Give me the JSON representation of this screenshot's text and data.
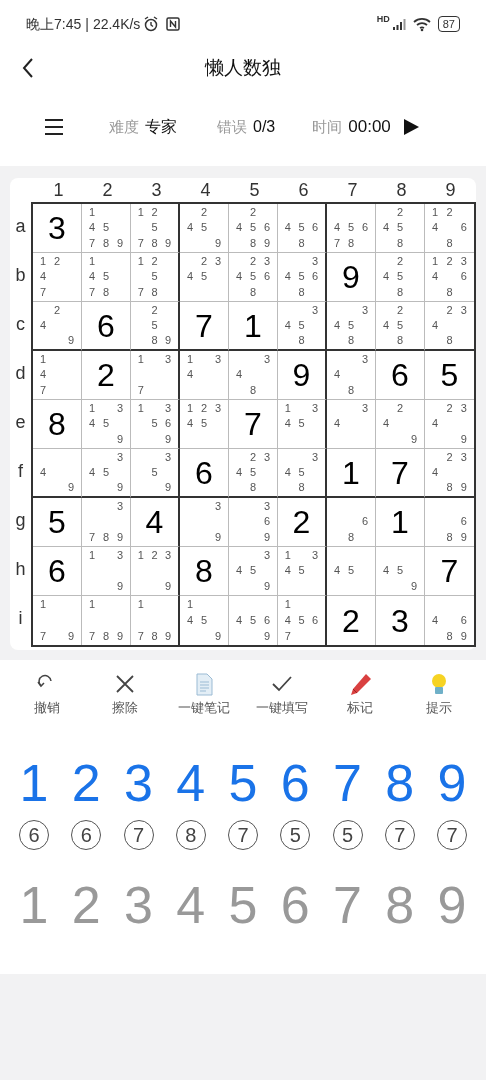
{
  "status_bar": {
    "time": "晚上7:45",
    "separator": "|",
    "speed": "22.4K/s",
    "network": "HD",
    "battery": "87"
  },
  "header": {
    "title": "懒人数独"
  },
  "info_bar": {
    "difficulty_label": "难度",
    "difficulty": "专家",
    "errors_label": "错误",
    "errors": "0/3",
    "time_label": "时间",
    "time": "00:00"
  },
  "column_labels": [
    "1",
    "2",
    "3",
    "4",
    "5",
    "6",
    "7",
    "8",
    "9"
  ],
  "row_labels": [
    "a",
    "b",
    "c",
    "d",
    "e",
    "f",
    "g",
    "h",
    "i"
  ],
  "grid": [
    [
      {
        "kind": "value",
        "value": "3"
      },
      {
        "kind": "notes",
        "notes": [
          {
            "digit": "1",
            "kind": "tl"
          },
          {
            "digit": "4",
            "kind": "ml"
          },
          {
            "digit": "5",
            "kind": "mc"
          },
          {
            "digit": "7",
            "kind": "bl"
          },
          {
            "digit": "8",
            "kind": "bc"
          },
          {
            "digit": "9",
            "kind": "br"
          }
        ]
      },
      {
        "kind": "notes",
        "notes": [
          {
            "digit": "1",
            "kind": "tl"
          },
          {
            "digit": "2",
            "kind": "tc"
          },
          {
            "digit": "5",
            "kind": "mc"
          },
          {
            "digit": "7",
            "kind": "bl"
          },
          {
            "digit": "8",
            "kind": "bc"
          },
          {
            "digit": "9",
            "kind": "br"
          }
        ]
      },
      {
        "kind": "notes",
        "notes": [
          {
            "digit": "2",
            "kind": "tc"
          },
          {
            "digit": "4",
            "kind": "ml"
          },
          {
            "digit": "5",
            "kind": "mc"
          },
          {
            "digit": "9",
            "kind": "br"
          }
        ]
      },
      {
        "kind": "notes",
        "notes": [
          {
            "digit": "2",
            "kind": "tc"
          },
          {
            "digit": "4",
            "kind": "ml"
          },
          {
            "digit": "5",
            "kind": "mc"
          },
          {
            "digit": "6",
            "kind": "mr"
          },
          {
            "digit": "8",
            "kind": "bc"
          },
          {
            "digit": "9",
            "kind": "br"
          }
        ]
      },
      {
        "kind": "notes",
        "notes": [
          {
            "digit": "4",
            "kind": "ml"
          },
          {
            "digit": "5",
            "kind": "mc"
          },
          {
            "digit": "6",
            "kind": "mr"
          },
          {
            "digit": "8",
            "kind": "bc"
          }
        ]
      },
      {
        "kind": "notes",
        "notes": [
          {
            "digit": "4",
            "kind": "ml"
          },
          {
            "digit": "5",
            "kind": "mc"
          },
          {
            "digit": "6",
            "kind": "mr"
          },
          {
            "digit": "7",
            "kind": "bl"
          },
          {
            "digit": "8",
            "kind": "bc"
          }
        ]
      },
      {
        "kind": "notes",
        "notes": [
          {
            "digit": "2",
            "kind": "tc"
          },
          {
            "digit": "4",
            "kind": "ml"
          },
          {
            "digit": "5",
            "kind": "mc"
          },
          {
            "digit": "8",
            "kind": "bc"
          }
        ]
      },
      {
        "kind": "notes",
        "notes": [
          {
            "digit": "1",
            "kind": "tl"
          },
          {
            "digit": "2",
            "kind": "tc"
          },
          {
            "digit": "4",
            "kind": "ml"
          },
          {
            "digit": "6",
            "kind": "mr"
          },
          {
            "digit": "8",
            "kind": "bc"
          }
        ]
      }
    ],
    [
      {
        "kind": "notes",
        "notes": [
          {
            "digit": "1",
            "kind": "tl"
          },
          {
            "digit": "2",
            "kind": "tc"
          },
          {
            "digit": "4",
            "kind": "ml"
          },
          {
            "digit": "7",
            "kind": "bl"
          }
        ]
      },
      {
        "kind": "notes",
        "notes": [
          {
            "digit": "1",
            "kind": "tl"
          },
          {
            "digit": "4",
            "kind": "ml"
          },
          {
            "digit": "5",
            "kind": "mc"
          },
          {
            "digit": "7",
            "kind": "bl"
          },
          {
            "digit": "8",
            "kind": "bc"
          }
        ]
      },
      {
        "kind": "notes",
        "notes": [
          {
            "digit": "1",
            "kind": "tl"
          },
          {
            "digit": "2",
            "kind": "tc"
          },
          {
            "digit": "5",
            "kind": "mc"
          },
          {
            "digit": "7",
            "kind": "bl"
          },
          {
            "digit": "8",
            "kind": "bc"
          }
        ]
      },
      {
        "kind": "notes",
        "notes": [
          {
            "digit": "2",
            "kind": "tc"
          },
          {
            "digit": "3",
            "kind": "tr"
          },
          {
            "digit": "4",
            "kind": "ml"
          },
          {
            "digit": "5",
            "kind": "mc"
          }
        ]
      },
      {
        "kind": "notes",
        "notes": [
          {
            "digit": "2",
            "kind": "tc"
          },
          {
            "digit": "3",
            "kind": "tr"
          },
          {
            "digit": "4",
            "kind": "ml"
          },
          {
            "digit": "5",
            "kind": "mc"
          },
          {
            "digit": "6",
            "kind": "mr"
          },
          {
            "digit": "8",
            "kind": "bc"
          }
        ]
      },
      {
        "kind": "notes",
        "notes": [
          {
            "digit": "3",
            "kind": "tr"
          },
          {
            "digit": "4",
            "kind": "ml"
          },
          {
            "digit": "5",
            "kind": "mc"
          },
          {
            "digit": "6",
            "kind": "mr"
          },
          {
            "digit": "8",
            "kind": "bc"
          }
        ]
      },
      {
        "kind": "value",
        "value": "9"
      },
      {
        "kind": "notes",
        "notes": [
          {
            "digit": "2",
            "kind": "tc"
          },
          {
            "digit": "4",
            "kind": "ml"
          },
          {
            "digit": "5",
            "kind": "mc"
          },
          {
            "digit": "8",
            "kind": "bc"
          }
        ]
      },
      {
        "kind": "notes",
        "notes": [
          {
            "digit": "1",
            "kind": "tl"
          },
          {
            "digit": "2",
            "kind": "tc"
          },
          {
            "digit": "3",
            "kind": "tr"
          },
          {
            "digit": "4",
            "kind": "ml"
          },
          {
            "digit": "6",
            "kind": "mr"
          },
          {
            "digit": "8",
            "kind": "bc"
          }
        ]
      }
    ],
    [
      {
        "kind": "notes",
        "notes": [
          {
            "digit": "2",
            "kind": "tc"
          },
          {
            "digit": "4",
            "kind": "ml"
          },
          {
            "digit": "9",
            "kind": "br"
          }
        ]
      },
      {
        "kind": "value",
        "value": "6"
      },
      {
        "kind": "notes",
        "notes": [
          {
            "digit": "2",
            "kind": "tc"
          },
          {
            "digit": "5",
            "kind": "mc"
          },
          {
            "digit": "8",
            "kind": "bc"
          },
          {
            "digit": "9",
            "kind": "br"
          }
        ]
      },
      {
        "kind": "value",
        "value": "7"
      },
      {
        "kind": "value",
        "value": "1"
      },
      {
        "kind": "notes",
        "notes": [
          {
            "digit": "3",
            "kind": "tr"
          },
          {
            "digit": "4",
            "kind": "ml"
          },
          {
            "digit": "5",
            "kind": "mc"
          },
          {
            "digit": "8",
            "kind": "bc"
          }
        ]
      },
      {
        "kind": "notes",
        "notes": [
          {
            "digit": "3",
            "kind": "tr"
          },
          {
            "digit": "4",
            "kind": "ml"
          },
          {
            "digit": "5",
            "kind": "mc"
          },
          {
            "digit": "8",
            "kind": "bc"
          }
        ]
      },
      {
        "kind": "notes",
        "notes": [
          {
            "digit": "2",
            "kind": "tc"
          },
          {
            "digit": "4",
            "kind": "ml"
          },
          {
            "digit": "5",
            "kind": "mc"
          },
          {
            "digit": "8",
            "kind": "bc"
          }
        ]
      },
      {
        "kind": "notes",
        "notes": [
          {
            "digit": "2",
            "kind": "tc"
          },
          {
            "digit": "3",
            "kind": "tr"
          },
          {
            "digit": "4",
            "kind": "ml"
          },
          {
            "digit": "8",
            "kind": "bc"
          }
        ]
      }
    ],
    [
      {
        "kind": "notes",
        "notes": [
          {
            "digit": "1",
            "kind": "tl"
          },
          {
            "digit": "4",
            "kind": "ml"
          },
          {
            "digit": "7",
            "kind": "bl"
          }
        ]
      },
      {
        "kind": "value",
        "value": "2"
      },
      {
        "kind": "notes",
        "notes": [
          {
            "digit": "1",
            "kind": "tl"
          },
          {
            "digit": "3",
            "kind": "tr"
          },
          {
            "digit": "7",
            "kind": "bl"
          }
        ]
      },
      {
        "kind": "notes",
        "notes": [
          {
            "digit": "1",
            "kind": "tl"
          },
          {
            "digit": "3",
            "kind": "tr"
          },
          {
            "digit": "4",
            "kind": "ml"
          }
        ]
      },
      {
        "kind": "notes",
        "notes": [
          {
            "digit": "3",
            "kind": "tr"
          },
          {
            "digit": "4",
            "kind": "ml"
          },
          {
            "digit": "8",
            "kind": "bc"
          }
        ]
      },
      {
        "kind": "value",
        "value": "9"
      },
      {
        "kind": "notes",
        "notes": [
          {
            "digit": "3",
            "kind": "tr"
          },
          {
            "digit": "4",
            "kind": "ml"
          },
          {
            "digit": "8",
            "kind": "bc"
          }
        ]
      },
      {
        "kind": "value",
        "value": "6"
      },
      {
        "kind": "value",
        "value": "5"
      }
    ],
    [
      {
        "kind": "value",
        "value": "8"
      },
      {
        "kind": "notes",
        "notes": [
          {
            "digit": "1",
            "kind": "tl"
          },
          {
            "digit": "3",
            "kind": "tr"
          },
          {
            "digit": "4",
            "kind": "ml"
          },
          {
            "digit": "5",
            "kind": "mc"
          },
          {
            "digit": "9",
            "kind": "br"
          }
        ]
      },
      {
        "kind": "notes",
        "notes": [
          {
            "digit": "1",
            "kind": "tl"
          },
          {
            "digit": "3",
            "kind": "tr"
          },
          {
            "digit": "5",
            "kind": "mc"
          },
          {
            "digit": "6",
            "kind": "mr"
          },
          {
            "digit": "9",
            "kind": "br"
          }
        ]
      },
      {
        "kind": "notes",
        "notes": [
          {
            "digit": "1",
            "kind": "tl"
          },
          {
            "digit": "2",
            "kind": "tc"
          },
          {
            "digit": "3",
            "kind": "tr"
          },
          {
            "digit": "4",
            "kind": "ml"
          },
          {
            "digit": "5",
            "kind": "mc"
          }
        ]
      },
      {
        "kind": "value",
        "value": "7"
      },
      {
        "kind": "notes",
        "notes": [
          {
            "digit": "1",
            "kind": "tl"
          },
          {
            "digit": "3",
            "kind": "tr"
          },
          {
            "digit": "4",
            "kind": "ml"
          },
          {
            "digit": "5",
            "kind": "mc"
          }
        ]
      },
      {
        "kind": "notes",
        "notes": [
          {
            "digit": "3",
            "kind": "tr"
          },
          {
            "digit": "4",
            "kind": "ml"
          }
        ]
      },
      {
        "kind": "notes",
        "notes": [
          {
            "digit": "2",
            "kind": "tc"
          },
          {
            "digit": "4",
            "kind": "ml"
          },
          {
            "digit": "9",
            "kind": "br"
          }
        ]
      },
      {
        "kind": "notes",
        "notes": [
          {
            "digit": "2",
            "kind": "tc"
          },
          {
            "digit": "3",
            "kind": "tr"
          },
          {
            "digit": "4",
            "kind": "ml"
          },
          {
            "digit": "9",
            "kind": "br"
          }
        ]
      }
    ],
    [
      {
        "kind": "notes",
        "notes": [
          {
            "digit": "4",
            "kind": "ml"
          },
          {
            "digit": "9",
            "kind": "br"
          }
        ]
      },
      {
        "kind": "notes",
        "notes": [
          {
            "digit": "3",
            "kind": "tr"
          },
          {
            "digit": "4",
            "kind": "ml"
          },
          {
            "digit": "5",
            "kind": "mc"
          },
          {
            "digit": "9",
            "kind": "br"
          }
        ]
      },
      {
        "kind": "notes",
        "notes": [
          {
            "digit": "3",
            "kind": "tr"
          },
          {
            "digit": "5",
            "kind": "mc"
          },
          {
            "digit": "9",
            "kind": "br"
          }
        ]
      },
      {
        "kind": "value",
        "value": "6"
      },
      {
        "kind": "notes",
        "notes": [
          {
            "digit": "2",
            "kind": "tc"
          },
          {
            "digit": "3",
            "kind": "tr"
          },
          {
            "digit": "4",
            "kind": "ml"
          },
          {
            "digit": "5",
            "kind": "mc"
          },
          {
            "digit": "8",
            "kind": "bc"
          }
        ]
      },
      {
        "kind": "notes",
        "notes": [
          {
            "digit": "3",
            "kind": "tr"
          },
          {
            "digit": "4",
            "kind": "ml"
          },
          {
            "digit": "5",
            "kind": "mc"
          },
          {
            "digit": "8",
            "kind": "bc"
          }
        ]
      },
      {
        "kind": "value",
        "value": "1"
      },
      {
        "kind": "value",
        "value": "7"
      },
      {
        "kind": "notes",
        "notes": [
          {
            "digit": "2",
            "kind": "tc"
          },
          {
            "digit": "3",
            "kind": "tr"
          },
          {
            "digit": "4",
            "kind": "ml"
          },
          {
            "digit": "8",
            "kind": "bc"
          },
          {
            "digit": "9",
            "kind": "br"
          }
        ]
      }
    ],
    [
      {
        "kind": "value",
        "value": "5"
      },
      {
        "kind": "notes",
        "notes": [
          {
            "digit": "3",
            "kind": "tr"
          },
          {
            "digit": "7",
            "kind": "bl"
          },
          {
            "digit": "8",
            "kind": "bc"
          },
          {
            "digit": "9",
            "kind": "br"
          }
        ]
      },
      {
        "kind": "value",
        "value": "4"
      },
      {
        "kind": "notes",
        "notes": [
          {
            "digit": "3",
            "kind": "tr"
          },
          {
            "digit": "9",
            "kind": "br"
          }
        ]
      },
      {
        "kind": "notes",
        "notes": [
          {
            "digit": "3",
            "kind": "tr"
          },
          {
            "digit": "6",
            "kind": "mr"
          },
          {
            "digit": "9",
            "kind": "br"
          }
        ]
      },
      {
        "kind": "value",
        "value": "2"
      },
      {
        "kind": "notes",
        "notes": [
          {
            "digit": "6",
            "kind": "mr"
          },
          {
            "digit": "8",
            "kind": "bc"
          }
        ]
      },
      {
        "kind": "value",
        "value": "1"
      },
      {
        "kind": "notes",
        "notes": [
          {
            "digit": "6",
            "kind": "mr"
          },
          {
            "digit": "8",
            "kind": "bc"
          },
          {
            "digit": "9",
            "kind": "br"
          }
        ]
      }
    ],
    [
      {
        "kind": "value",
        "value": "6"
      },
      {
        "kind": "notes",
        "notes": [
          {
            "digit": "1",
            "kind": "tl"
          },
          {
            "digit": "3",
            "kind": "tr"
          },
          {
            "digit": "9",
            "kind": "br"
          }
        ]
      },
      {
        "kind": "notes",
        "notes": [
          {
            "digit": "1",
            "kind": "tl"
          },
          {
            "digit": "2",
            "kind": "tc"
          },
          {
            "digit": "3",
            "kind": "tr"
          },
          {
            "digit": "9",
            "kind": "br"
          }
        ]
      },
      {
        "kind": "value",
        "value": "8"
      },
      {
        "kind": "notes",
        "notes": [
          {
            "digit": "3",
            "kind": "tr"
          },
          {
            "digit": "4",
            "kind": "ml"
          },
          {
            "digit": "5",
            "kind": "mc"
          },
          {
            "digit": "9",
            "kind": "br"
          }
        ]
      },
      {
        "kind": "notes",
        "notes": [
          {
            "digit": "1",
            "kind": "tl"
          },
          {
            "digit": "3",
            "kind": "tr"
          },
          {
            "digit": "4",
            "kind": "ml"
          },
          {
            "digit": "5",
            "kind": "mc"
          }
        ]
      },
      {
        "kind": "notes",
        "notes": [
          {
            "digit": "4",
            "kind": "ml"
          },
          {
            "digit": "5",
            "kind": "mc"
          }
        ]
      },
      {
        "kind": "notes",
        "notes": [
          {
            "digit": "4",
            "kind": "ml"
          },
          {
            "digit": "5",
            "kind": "mc"
          },
          {
            "digit": "9",
            "kind": "br"
          }
        ]
      },
      {
        "kind": "value",
        "value": "7"
      }
    ],
    [
      {
        "kind": "notes",
        "notes": [
          {
            "digit": "1",
            "kind": "tl"
          },
          {
            "digit": "7",
            "kind": "bl"
          },
          {
            "digit": "9",
            "kind": "br"
          }
        ]
      },
      {
        "kind": "notes",
        "notes": [
          {
            "digit": "1",
            "kind": "tl"
          },
          {
            "digit": "7",
            "kind": "bl"
          },
          {
            "digit": "8",
            "kind": "bc"
          },
          {
            "digit": "9",
            "kind": "br"
          }
        ]
      },
      {
        "kind": "notes",
        "notes": [
          {
            "digit": "1",
            "kind": "tl"
          },
          {
            "digit": "7",
            "kind": "bl"
          },
          {
            "digit": "8",
            "kind": "bc"
          },
          {
            "digit": "9",
            "kind": "br"
          }
        ]
      },
      {
        "kind": "notes",
        "notes": [
          {
            "digit": "1",
            "kind": "tl"
          },
          {
            "digit": "4",
            "kind": "ml"
          },
          {
            "digit": "5",
            "kind": "mc"
          },
          {
            "digit": "9",
            "kind": "br"
          }
        ]
      },
      {
        "kind": "notes",
        "notes": [
          {
            "digit": "4",
            "kind": "ml"
          },
          {
            "digit": "5",
            "kind": "mc"
          },
          {
            "digit": "6",
            "kind": "mr"
          },
          {
            "digit": "9",
            "kind": "br"
          }
        ]
      },
      {
        "kind": "notes",
        "notes": [
          {
            "digit": "1",
            "kind": "tl"
          },
          {
            "digit": "4",
            "kind": "ml"
          },
          {
            "digit": "5",
            "kind": "mc"
          },
          {
            "digit": "6",
            "kind": "mr"
          },
          {
            "digit": "7",
            "kind": "bl"
          }
        ]
      },
      {
        "kind": "value",
        "value": "2"
      },
      {
        "kind": "value",
        "value": "3"
      },
      {
        "kind": "notes",
        "notes": [
          {
            "digit": "4",
            "kind": "ml"
          },
          {
            "digit": "6",
            "kind": "mr"
          },
          {
            "digit": "8",
            "kind": "bc"
          },
          {
            "digit": "9",
            "kind": "br"
          }
        ]
      }
    ]
  ],
  "tools": [
    {
      "kind": "undo",
      "label": "撤销"
    },
    {
      "kind": "erase",
      "label": "擦除"
    },
    {
      "kind": "notes",
      "label": "一键笔记"
    },
    {
      "kind": "fill",
      "label": "一键填写"
    },
    {
      "kind": "mark",
      "label": "标记"
    },
    {
      "kind": "hint",
      "label": "提示"
    }
  ],
  "number_pad": [
    {
      "digit": "1",
      "remaining": "6"
    },
    {
      "digit": "2",
      "remaining": "6"
    },
    {
      "digit": "3",
      "remaining": "7"
    },
    {
      "digit": "4",
      "remaining": "8"
    },
    {
      "digit": "5",
      "remaining": "7"
    },
    {
      "digit": "6",
      "remaining": "5"
    },
    {
      "digit": "7",
      "remaining": "5"
    },
    {
      "digit": "8",
      "remaining": "7"
    },
    {
      "digit": "9",
      "remaining": "7"
    }
  ],
  "note_pad": [
    "1",
    "2",
    "3",
    "4",
    "5",
    "6",
    "7",
    "8",
    "9"
  ]
}
